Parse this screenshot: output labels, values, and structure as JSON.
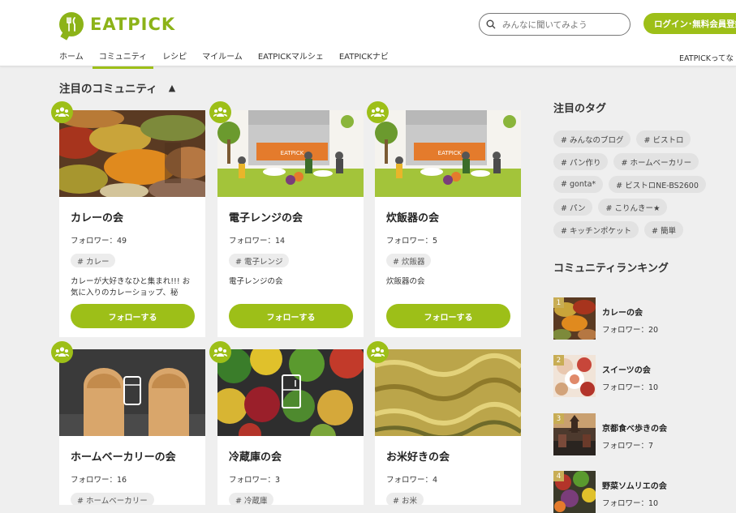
{
  "header": {
    "logo_text": "EATPICK",
    "search_placeholder": "みんなに聞いてみよう",
    "login_label": "ログイン･無料会員登録",
    "about_label": "EATPICKってな",
    "nav": [
      {
        "label": "ホーム"
      },
      {
        "label": "コミュニティ"
      },
      {
        "label": "レシピ"
      },
      {
        "label": "マイルーム"
      },
      {
        "label": "EATPICKマルシェ"
      },
      {
        "label": "EATPICKナビ"
      }
    ]
  },
  "featured": {
    "title": "注目のコミュニティ",
    "toggle_glyph": "▲",
    "cards": [
      {
        "title": "カレーの会",
        "followers": "フォロワー：49",
        "tag": "# カレー",
        "description": "カレーが大好きなひと集まれ!!! お気に入りのカレーショップ、秘",
        "follow_label": "フォローする"
      },
      {
        "title": "電子レンジの会",
        "followers": "フォロワー：14",
        "tag": "# 電子レンジ",
        "description": "電子レンジの会",
        "follow_label": "フォローする"
      },
      {
        "title": "炊飯器の会",
        "followers": "フォロワー：5",
        "tag": "# 炊飯器",
        "description": "炊飯器の会",
        "follow_label": "フォローする"
      },
      {
        "title": "ホームベーカリーの会",
        "followers": "フォロワー：16",
        "tag": "# ホームベーカリー"
      },
      {
        "title": "冷蔵庫の会",
        "followers": "フォロワー：3",
        "tag": "# 冷蔵庫"
      },
      {
        "title": "お米好きの会",
        "followers": "フォロワー：4",
        "tag": "# お米"
      }
    ],
    "marche_sign": "EATPICK"
  },
  "sidebar": {
    "tags_title": "注目のタグ",
    "tags": [
      "# みんなのブログ",
      "# ビストロ",
      "# パン作り",
      "# ホームベーカリー",
      "# gonta*",
      "# ビストロNE-BS2600",
      "# パン",
      "# こりんきー★",
      "# キッチンポケット",
      "# 簡単"
    ],
    "ranking_title": "コミュニティランキング",
    "ranking": [
      {
        "rank": "1",
        "name": "カレーの会",
        "followers": "フォロワー：20"
      },
      {
        "rank": "2",
        "name": "スイーツの会",
        "followers": "フォロワー：10"
      },
      {
        "rank": "3",
        "name": "京都食べ歩きの会",
        "followers": "フォロワー：7"
      },
      {
        "rank": "4",
        "name": "野菜ソムリエの会",
        "followers": "フォロワー：10"
      }
    ]
  },
  "colors": {
    "brand": "#9dbf18"
  }
}
